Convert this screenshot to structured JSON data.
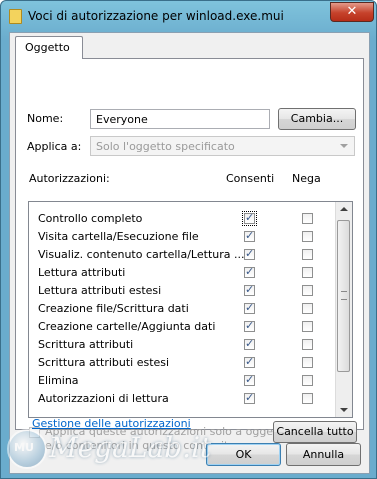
{
  "window": {
    "title": "Voci di autorizzazione per winload.exe.mui",
    "close_label": "✕"
  },
  "tab": {
    "label": "Oggetto"
  },
  "name_row": {
    "label": "Nome:",
    "value": "Everyone",
    "button": "Cambia..."
  },
  "apply_row": {
    "label": "Applica a:",
    "value": "Solo l'oggetto specificato"
  },
  "permissions": {
    "header": "Autorizzazioni:",
    "allow_header": "Consenti",
    "deny_header": "Nega",
    "rows": [
      {
        "name": "Controllo completo",
        "allow": true,
        "deny": false
      },
      {
        "name": "Visita cartella/Esecuzione file",
        "allow": true,
        "deny": false
      },
      {
        "name": "Visualiz. contenuto cartella/Lettura ...",
        "allow": true,
        "deny": false
      },
      {
        "name": "Lettura attributi",
        "allow": true,
        "deny": false
      },
      {
        "name": "Lettura attributi estesi",
        "allow": true,
        "deny": false
      },
      {
        "name": "Creazione file/Scrittura dati",
        "allow": true,
        "deny": false
      },
      {
        "name": "Creazione cartelle/Aggiunta dati",
        "allow": true,
        "deny": false
      },
      {
        "name": "Scrittura attributi",
        "allow": true,
        "deny": false
      },
      {
        "name": "Scrittura attributi estesi",
        "allow": true,
        "deny": false
      },
      {
        "name": "Elimina",
        "allow": true,
        "deny": false
      },
      {
        "name": "Autorizzazioni di lettura",
        "allow": true,
        "deny": false
      }
    ]
  },
  "apply_children": {
    "line1": "Applica queste autorizzazioni solo a oggetti",
    "line2": "e/o contenitori in questo contenitore"
  },
  "clear_all_button": "Cancella tutto",
  "manage_link": "Gestione delle autorizzazioni",
  "ok_button": "OK",
  "cancel_button": "Annulla",
  "watermark": {
    "badge": "MU",
    "text": "MegaLab.it"
  }
}
